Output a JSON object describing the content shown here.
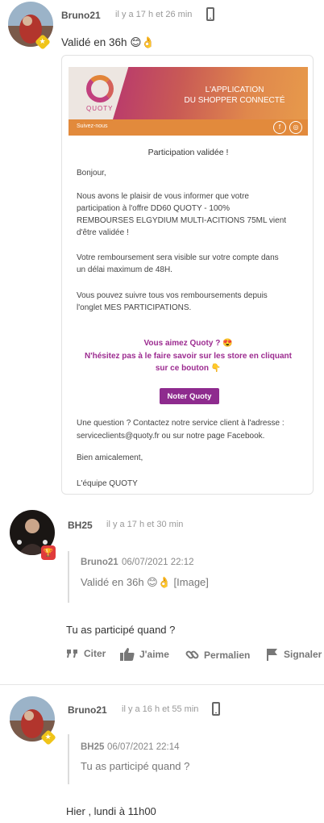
{
  "posts": [
    {
      "username": "Bruno21",
      "timestamp": "il y a 17 h et 26 min",
      "text": "Validé en 36h",
      "emojis": "😊👌",
      "email": {
        "brand": "QUOTY",
        "tagline_1": "L'APPLICATION",
        "tagline_2": "DU SHOPPER CONNECTÉ",
        "follow": "Suivez-nous",
        "subject": "Participation validée !",
        "lines": [
          "Bonjour,",
          "Nous avons le plaisir de vous informer que votre",
          "participation  à l'offre DD60 QUOTY - 100%",
          "REMBOURSES ELGYDIUM MULTI-ACITIONS 75ML vient",
          "d'être validée !",
          "Votre remboursement sera visible sur votre compte dans",
          "un délai maximum de 48H.",
          "Vous pouvez suivre tous vos remboursements depuis",
          "l'onglet MES PARTICIPATIONS."
        ],
        "promo_1": "Vous aimez Quoty ? 😍",
        "promo_2": "N'hésitez pas à le faire savoir sur les store en cliquant",
        "promo_3": "sur ce bouton  👇",
        "button": "Noter Quoty",
        "contact_1": "Une question ? Contactez notre service client à l'adresse :",
        "contact_2": "serviceclients@quoty.fr ou sur notre page Facebook.",
        "closing": "Bien amicalement,",
        "signature": "L'équipe QUOTY"
      }
    },
    {
      "username": "BH25",
      "timestamp": "il y a 17 h et 30 min",
      "quote": {
        "author": "Bruno21",
        "date": "06/07/2021 22:12",
        "text": "Validé en 36h",
        "emojis": "😊👌",
        "image_label": "[Image]"
      },
      "text": "Tu as participé quand ?",
      "actions": {
        "cite": "Citer",
        "like": "J'aime",
        "permalink": "Permalien",
        "report": "Signaler"
      }
    },
    {
      "username": "Bruno21",
      "timestamp": "il y a 16 h et 55 min",
      "quote": {
        "author": "BH25",
        "date": "06/07/2021 22:14",
        "text": "Tu as participé quand ?"
      },
      "text": "Hier , lundi à 11h00"
    }
  ],
  "colors": {
    "quoty_purple": "#8e2b8e",
    "badge_yellow": "#f0c419",
    "badge_red": "#e03b3b"
  }
}
